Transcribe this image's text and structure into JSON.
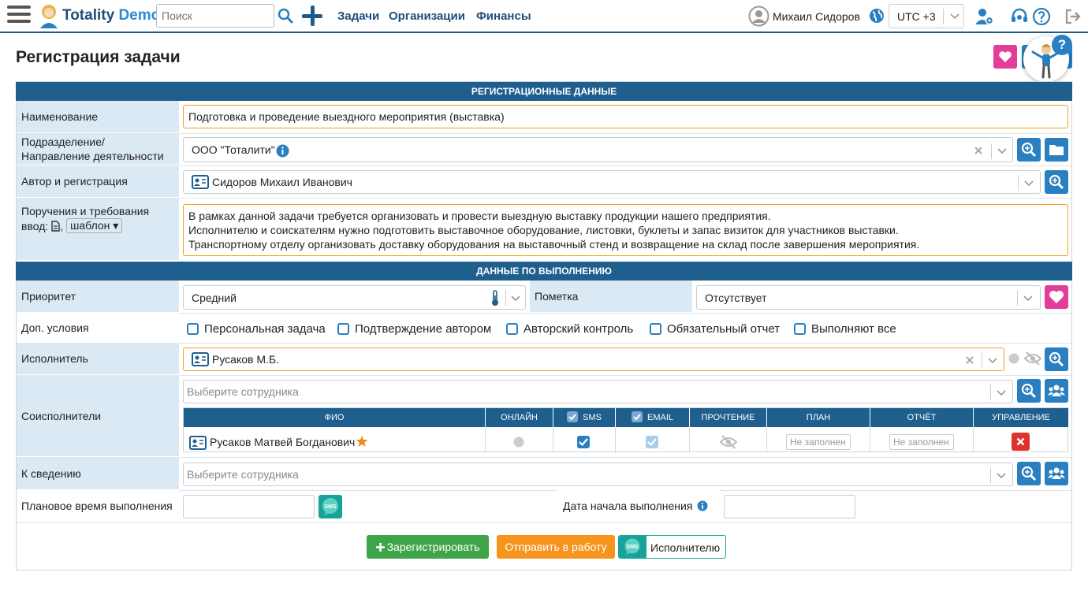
{
  "app": {
    "logo_main": "Totality",
    "logo_demo": "Demo",
    "search_placeholder": "Поиск",
    "nav": [
      "Задачи",
      "Организации",
      "Финансы"
    ],
    "user_name": "Михаил Сидоров",
    "timezone": "UTC +3"
  },
  "page": {
    "title": "Регистрация задачи"
  },
  "sections": {
    "registration": "РЕГИСТРАЦИОННЫЕ ДАННЫЕ",
    "execution": "ДАННЫЕ ПО ВЫПОЛНЕНИЮ"
  },
  "fields": {
    "name_label": "Наименование",
    "name_value": "Подготовка и проведение выездного мероприятия (выставка)",
    "division_label_1": "Подразделение/",
    "division_label_2": "Направление деятельности",
    "division_value": "ООО \"Тоталити\"",
    "author_label": "Автор и регистрация",
    "author_value": "Сидоров Михаил Иванович",
    "instructions_label_1": "Поручения и требования",
    "instructions_label_2": "ввод:",
    "template_select": "шаблон",
    "instructions_lines": [
      "В рамках данной задачи требуется организовать и провести выездную выставку продукции нашего предприятия.",
      "Исполнителю и соискателям нужно подготовить выставочное оборудование, листовки, буклеты и запас визиток для участников выставки.",
      "Транспортному отделу организовать доставку оборудования на выставочный стенд и возвращение на склад после завершения мероприятия."
    ],
    "priority_label": "Приоритет",
    "priority_value": "Средний",
    "mark_label": "Пометка",
    "mark_value": "Отсутствует",
    "extra_label": "Доп. условия",
    "extra_options": [
      "Персональная задача",
      "Подтверждение автором",
      "Авторский контроль",
      "Обязательный отчет",
      "Выполняют все"
    ],
    "executor_label": "Исполнитель",
    "executor_value": "Русаков М.Б.",
    "coexec_label": "Соисполнители",
    "coexec_placeholder": "Выберите сотрудника",
    "info_label": "К сведению",
    "info_placeholder": "Выберите сотрудника",
    "plan_time_label": "Плановое время выполнения",
    "start_date_label": "Дата начала выполнения"
  },
  "coexec_table": {
    "headers": {
      "fio": "ФИО",
      "online": "ОНЛАЙН",
      "sms": "SMS",
      "email": "EMAIL",
      "read": "ПРОЧТЕНИЕ",
      "plan": "ПЛАН",
      "report": "ОТЧЁТ",
      "manage": "УПРАВЛЕНИЕ"
    },
    "rows": [
      {
        "name": "Русаков Матвей Богданович",
        "plan": "Не заполнен",
        "report": "Не заполнен"
      }
    ]
  },
  "buttons": {
    "register": "Зарегистрировать",
    "send": "Отправить в работу",
    "sms_executor": "Исполнителю"
  },
  "colors": {
    "primary": "#1f5f8e",
    "accent_blue": "#2a7fc0",
    "pink": "#e23d9b",
    "orange": "#f7941d",
    "green": "#3fa447",
    "teal": "#18a39a",
    "label_bg": "#dbe9f5"
  }
}
